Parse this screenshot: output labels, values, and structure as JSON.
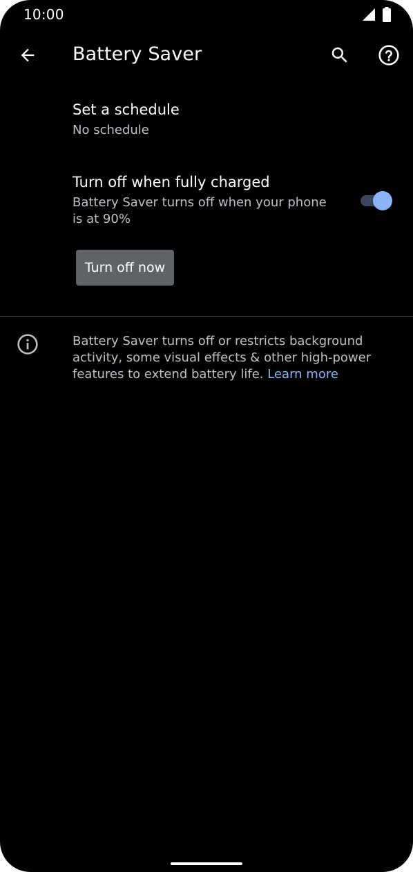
{
  "status_bar": {
    "time": "10:00",
    "icons": [
      "cellular-signal-icon",
      "battery-icon"
    ]
  },
  "app_bar": {
    "title": "Battery Saver",
    "back_icon": "arrow-back-icon",
    "search_icon": "search-icon",
    "help_icon": "help-icon"
  },
  "preferences": {
    "schedule": {
      "title": "Set a schedule",
      "summary": "No schedule"
    },
    "turn_off_charged": {
      "title": "Turn off when fully charged",
      "summary": "Battery Saver turns off when your phone is at 90%",
      "enabled": true
    }
  },
  "turn_off_button": {
    "label": "Turn off now"
  },
  "footer": {
    "icon": "info-icon",
    "text": "Battery Saver turns off or restricts background activity, some visual effects & other high-power features to extend battery life. ",
    "link": "Learn more"
  },
  "colors": {
    "background": "#000000",
    "accent": "#8ab4f8",
    "switch_track": "#3b4560",
    "button": "#5f6368",
    "secondary_text": "#bdc1c6"
  }
}
